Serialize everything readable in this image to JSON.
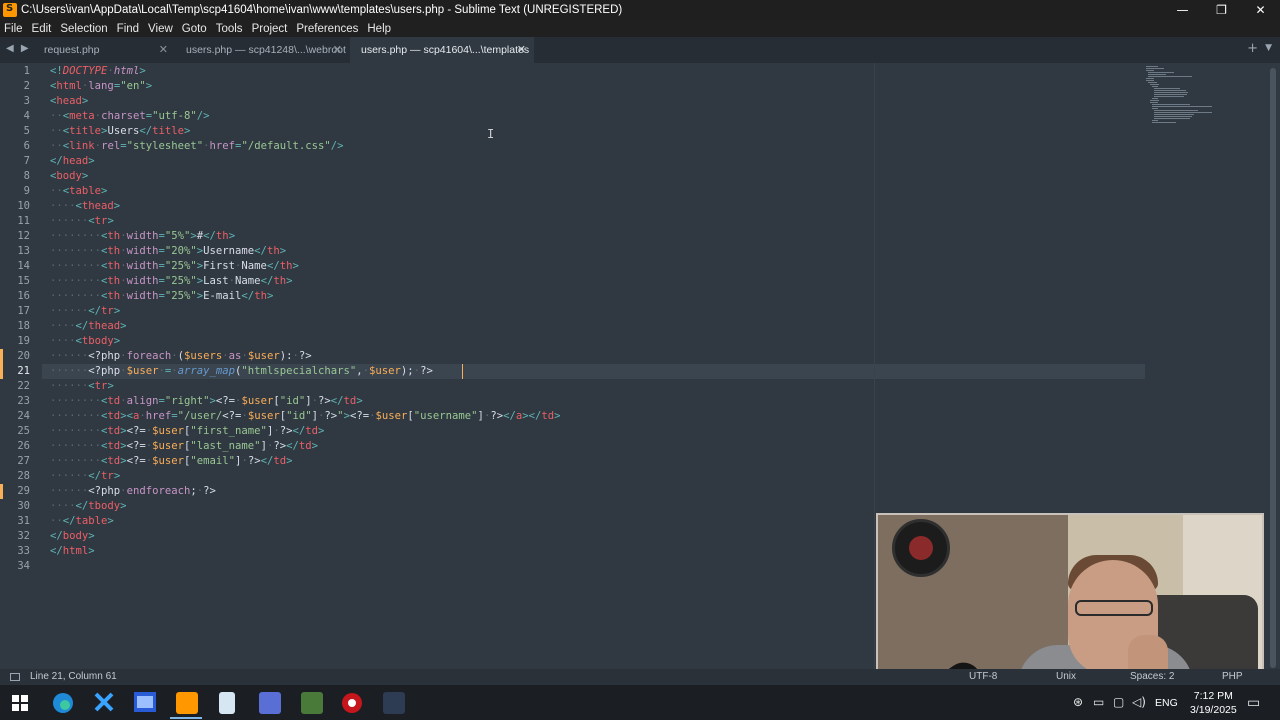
{
  "window": {
    "title": "C:\\Users\\ivan\\AppData\\Local\\Temp\\scp41604\\home\\ivan\\www\\templates\\users.php - Sublime Text (UNREGISTERED)",
    "controls": [
      "—",
      "❐",
      "✕"
    ]
  },
  "menu": [
    "File",
    "Edit",
    "Selection",
    "Find",
    "View",
    "Goto",
    "Tools",
    "Project",
    "Preferences",
    "Help"
  ],
  "tabs": [
    {
      "label": "request.php",
      "active": false
    },
    {
      "label": "users.php — scp41248\\...\\webroot",
      "active": false
    },
    {
      "label": "users.php — scp41604\\...\\templates",
      "active": true
    }
  ],
  "editor": {
    "line_numbers": [
      "1",
      "2",
      "3",
      "4",
      "5",
      "6",
      "7",
      "8",
      "9",
      "10",
      "11",
      "12",
      "13",
      "14",
      "15",
      "16",
      "17",
      "18",
      "19",
      "20",
      "21",
      "22",
      "23",
      "24",
      "25",
      "26",
      "27",
      "28",
      "29",
      "30",
      "31",
      "32",
      "33",
      "34"
    ],
    "current_line": "21",
    "modified_lines": [
      "20",
      "21",
      "29"
    ]
  },
  "status": {
    "position": "Line 21, Column 61",
    "encoding": "UTF-8",
    "line_endings": "Unix",
    "indentation": "Spaces: 2",
    "syntax": "PHP"
  },
  "taskbar": {
    "language": "ENG",
    "time": "7:12 PM",
    "date": "3/19/2025"
  },
  "colors": {
    "editor_bg": "#303841",
    "tag": "#ec5f66",
    "string": "#99c794",
    "variable": "#f9ae58",
    "keyword": "#c695c6"
  }
}
